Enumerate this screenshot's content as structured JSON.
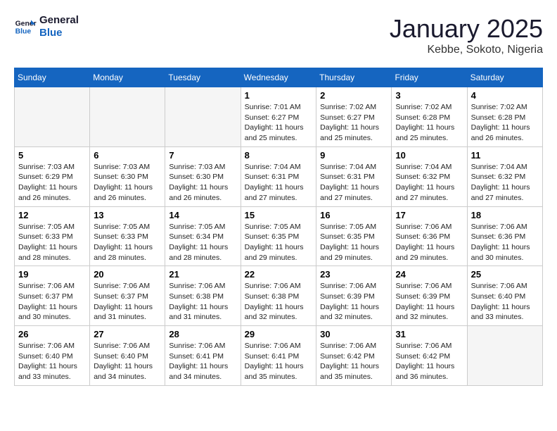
{
  "logo": {
    "line1": "General",
    "line2": "Blue"
  },
  "title": "January 2025",
  "location": "Kebbe, Sokoto, Nigeria",
  "weekdays": [
    "Sunday",
    "Monday",
    "Tuesday",
    "Wednesday",
    "Thursday",
    "Friday",
    "Saturday"
  ],
  "weeks": [
    [
      {
        "day": null,
        "info": null
      },
      {
        "day": null,
        "info": null
      },
      {
        "day": null,
        "info": null
      },
      {
        "day": "1",
        "info": "Sunrise: 7:01 AM\nSunset: 6:27 PM\nDaylight: 11 hours and 25 minutes."
      },
      {
        "day": "2",
        "info": "Sunrise: 7:02 AM\nSunset: 6:27 PM\nDaylight: 11 hours and 25 minutes."
      },
      {
        "day": "3",
        "info": "Sunrise: 7:02 AM\nSunset: 6:28 PM\nDaylight: 11 hours and 25 minutes."
      },
      {
        "day": "4",
        "info": "Sunrise: 7:02 AM\nSunset: 6:28 PM\nDaylight: 11 hours and 26 minutes."
      }
    ],
    [
      {
        "day": "5",
        "info": "Sunrise: 7:03 AM\nSunset: 6:29 PM\nDaylight: 11 hours and 26 minutes."
      },
      {
        "day": "6",
        "info": "Sunrise: 7:03 AM\nSunset: 6:30 PM\nDaylight: 11 hours and 26 minutes."
      },
      {
        "day": "7",
        "info": "Sunrise: 7:03 AM\nSunset: 6:30 PM\nDaylight: 11 hours and 26 minutes."
      },
      {
        "day": "8",
        "info": "Sunrise: 7:04 AM\nSunset: 6:31 PM\nDaylight: 11 hours and 27 minutes."
      },
      {
        "day": "9",
        "info": "Sunrise: 7:04 AM\nSunset: 6:31 PM\nDaylight: 11 hours and 27 minutes."
      },
      {
        "day": "10",
        "info": "Sunrise: 7:04 AM\nSunset: 6:32 PM\nDaylight: 11 hours and 27 minutes."
      },
      {
        "day": "11",
        "info": "Sunrise: 7:04 AM\nSunset: 6:32 PM\nDaylight: 11 hours and 27 minutes."
      }
    ],
    [
      {
        "day": "12",
        "info": "Sunrise: 7:05 AM\nSunset: 6:33 PM\nDaylight: 11 hours and 28 minutes."
      },
      {
        "day": "13",
        "info": "Sunrise: 7:05 AM\nSunset: 6:33 PM\nDaylight: 11 hours and 28 minutes."
      },
      {
        "day": "14",
        "info": "Sunrise: 7:05 AM\nSunset: 6:34 PM\nDaylight: 11 hours and 28 minutes."
      },
      {
        "day": "15",
        "info": "Sunrise: 7:05 AM\nSunset: 6:35 PM\nDaylight: 11 hours and 29 minutes."
      },
      {
        "day": "16",
        "info": "Sunrise: 7:05 AM\nSunset: 6:35 PM\nDaylight: 11 hours and 29 minutes."
      },
      {
        "day": "17",
        "info": "Sunrise: 7:06 AM\nSunset: 6:36 PM\nDaylight: 11 hours and 29 minutes."
      },
      {
        "day": "18",
        "info": "Sunrise: 7:06 AM\nSunset: 6:36 PM\nDaylight: 11 hours and 30 minutes."
      }
    ],
    [
      {
        "day": "19",
        "info": "Sunrise: 7:06 AM\nSunset: 6:37 PM\nDaylight: 11 hours and 30 minutes."
      },
      {
        "day": "20",
        "info": "Sunrise: 7:06 AM\nSunset: 6:37 PM\nDaylight: 11 hours and 31 minutes."
      },
      {
        "day": "21",
        "info": "Sunrise: 7:06 AM\nSunset: 6:38 PM\nDaylight: 11 hours and 31 minutes."
      },
      {
        "day": "22",
        "info": "Sunrise: 7:06 AM\nSunset: 6:38 PM\nDaylight: 11 hours and 32 minutes."
      },
      {
        "day": "23",
        "info": "Sunrise: 7:06 AM\nSunset: 6:39 PM\nDaylight: 11 hours and 32 minutes."
      },
      {
        "day": "24",
        "info": "Sunrise: 7:06 AM\nSunset: 6:39 PM\nDaylight: 11 hours and 32 minutes."
      },
      {
        "day": "25",
        "info": "Sunrise: 7:06 AM\nSunset: 6:40 PM\nDaylight: 11 hours and 33 minutes."
      }
    ],
    [
      {
        "day": "26",
        "info": "Sunrise: 7:06 AM\nSunset: 6:40 PM\nDaylight: 11 hours and 33 minutes."
      },
      {
        "day": "27",
        "info": "Sunrise: 7:06 AM\nSunset: 6:40 PM\nDaylight: 11 hours and 34 minutes."
      },
      {
        "day": "28",
        "info": "Sunrise: 7:06 AM\nSunset: 6:41 PM\nDaylight: 11 hours and 34 minutes."
      },
      {
        "day": "29",
        "info": "Sunrise: 7:06 AM\nSunset: 6:41 PM\nDaylight: 11 hours and 35 minutes."
      },
      {
        "day": "30",
        "info": "Sunrise: 7:06 AM\nSunset: 6:42 PM\nDaylight: 11 hours and 35 minutes."
      },
      {
        "day": "31",
        "info": "Sunrise: 7:06 AM\nSunset: 6:42 PM\nDaylight: 11 hours and 36 minutes."
      },
      {
        "day": null,
        "info": null
      }
    ]
  ]
}
